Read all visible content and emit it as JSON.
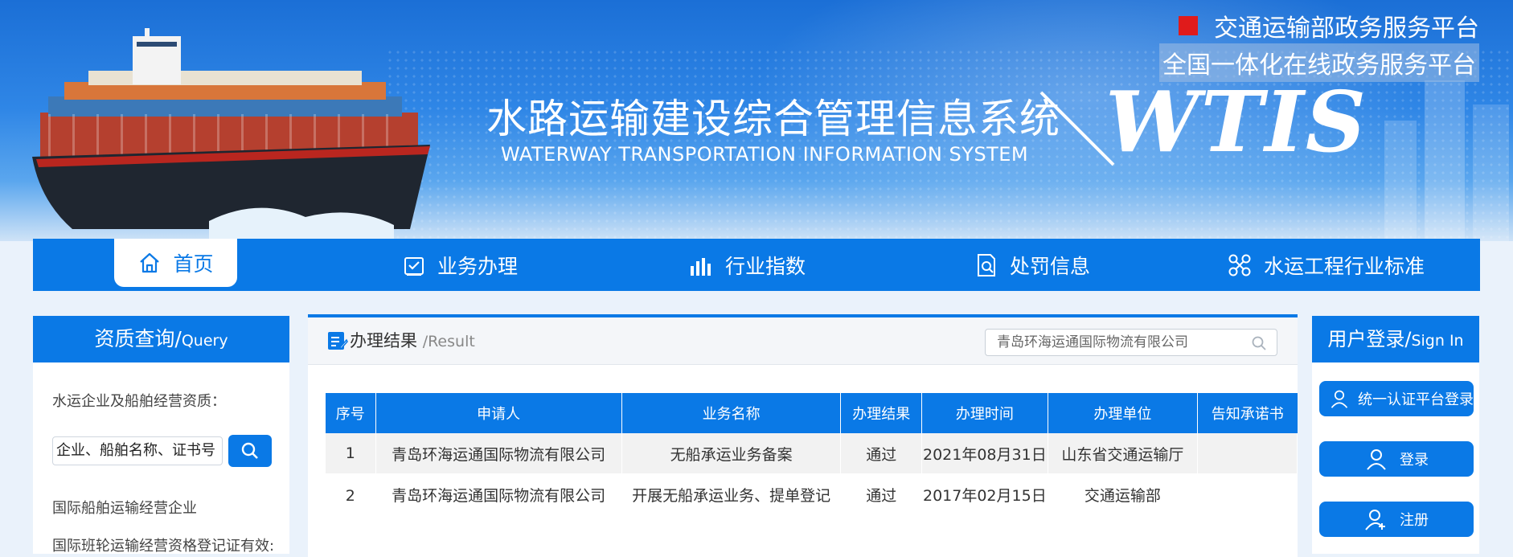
{
  "header": {
    "system_title": "水路运输建设综合管理信息系统",
    "system_subtitle": "WATERWAY TRANSPORTATION INFORMATION SYSTEM",
    "logo_text": "WTIS",
    "platform_line1": "交通运输部政务服务平台",
    "platform_line2": "全国一体化在线政务服务平台"
  },
  "nav": {
    "items": [
      {
        "label": "首页",
        "icon": "home-icon",
        "active": true
      },
      {
        "label": "业务办理",
        "icon": "checklist-icon"
      },
      {
        "label": "行业指数",
        "icon": "bar-chart-icon"
      },
      {
        "label": "处罚信息",
        "icon": "document-search-icon"
      },
      {
        "label": "水运工程行业标准",
        "icon": "scissors-cross-icon"
      }
    ]
  },
  "left_panel": {
    "title": "资质查询/",
    "title_en": "Query",
    "label": "水运企业及船舶经营资质：",
    "input_value": "企业、船舶名称、证书号（",
    "links": [
      "国际船舶运输经营企业",
      "国际班轮运输经营资格登记证有效:"
    ]
  },
  "center_panel": {
    "title": "办理结果",
    "title_en": "/Result",
    "search_value": "青岛环海运通国际物流有限公司",
    "table": {
      "headers": [
        "序号",
        "申请人",
        "业务名称",
        "办理结果",
        "办理时间",
        "办理单位",
        "告知承诺书"
      ],
      "rows": [
        [
          "1",
          "青岛环海运通国际物流有限公司",
          "无船承运业务备案",
          "通过",
          "2021年08月31日",
          "山东省交通运输厅",
          ""
        ],
        [
          "2",
          "青岛环海运通国际物流有限公司",
          "开展无船承运业务、提单登记",
          "通过",
          "2017年02月15日",
          "交通运输部",
          ""
        ]
      ]
    }
  },
  "right_panel": {
    "title": "用户登录/",
    "title_en": "Sign In",
    "buttons": [
      "统一认证平台登录",
      "登录",
      "注册"
    ]
  },
  "colors": {
    "primary": "#0a79e6",
    "header_gradient_top": "#1b6fd6",
    "red_marker": "#e01b1b"
  }
}
